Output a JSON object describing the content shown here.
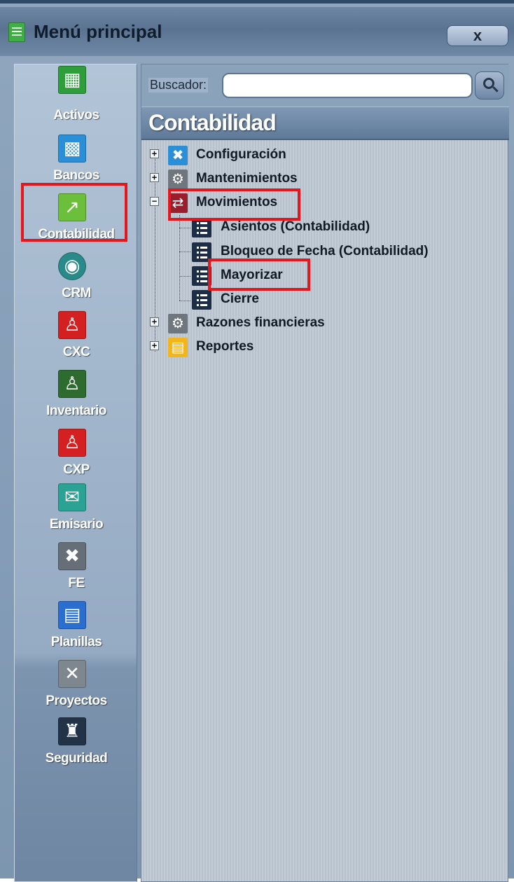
{
  "window": {
    "title": "Menú principal",
    "close_label": "x"
  },
  "sidebar": {
    "items": [
      {
        "label": "Activos",
        "icon": "cash-register-icon",
        "color": "#2e9e3a"
      },
      {
        "label": "Bancos",
        "icon": "briefcase-icon",
        "color": "#2b8fd8"
      },
      {
        "label": "Contabilidad",
        "icon": "trend-chart-icon",
        "color": "#6cbf3a",
        "selected": true
      },
      {
        "label": "CRM",
        "icon": "globe-icon",
        "color": "#2a8a8a"
      },
      {
        "label": "CXC",
        "icon": "person-bag-icon",
        "color": "#d42020"
      },
      {
        "label": "Inventario",
        "icon": "person-box-icon",
        "color": "#2d6b2e"
      },
      {
        "label": "CXP",
        "icon": "person-coins-icon",
        "color": "#d42020"
      },
      {
        "label": "Emisario",
        "icon": "envelope-icon",
        "color": "#2aa394"
      },
      {
        "label": "FE",
        "icon": "tools-icon",
        "color": "#666f78"
      },
      {
        "label": "Planillas",
        "icon": "document-icon",
        "color": "#2a6fd0"
      },
      {
        "label": "Proyectos",
        "icon": "pencil-ruler-icon",
        "color": "#7e8690"
      },
      {
        "label": "Seguridad",
        "icon": "castle-icon",
        "color": "#233347"
      }
    ]
  },
  "search": {
    "label": "Buscador:",
    "value": "",
    "placeholder": ""
  },
  "section": {
    "title": "Contabilidad"
  },
  "tree": {
    "nodes": [
      {
        "label": "Configuración",
        "expander": "+",
        "icon": "tools-icon",
        "color": "#2b8fd8"
      },
      {
        "label": "Mantenimientos",
        "expander": "+",
        "icon": "gear-icon",
        "color": "#70767d"
      },
      {
        "label": "Movimientos",
        "expander": "−",
        "icon": "shuffle-icon",
        "color": "#9b1c2a"
      },
      {
        "label": "Asientos (Contabilidad)",
        "icon": "list-icon",
        "color": "#1d2d45"
      },
      {
        "label": "Bloqueo de Fecha (Contabilidad)",
        "icon": "list-icon",
        "color": "#1d2d45"
      },
      {
        "label": "Mayorizar",
        "icon": "list-icon",
        "color": "#1d2d45"
      },
      {
        "label": "Cierre",
        "icon": "list-icon",
        "color": "#1d2d45"
      },
      {
        "label": "Razones financieras",
        "expander": "+",
        "icon": "gear-icon",
        "color": "#70767d"
      },
      {
        "label": "Reportes",
        "expander": "+",
        "icon": "report-icon",
        "color": "#f2b51c"
      }
    ]
  },
  "highlight_color": "#e5161c"
}
